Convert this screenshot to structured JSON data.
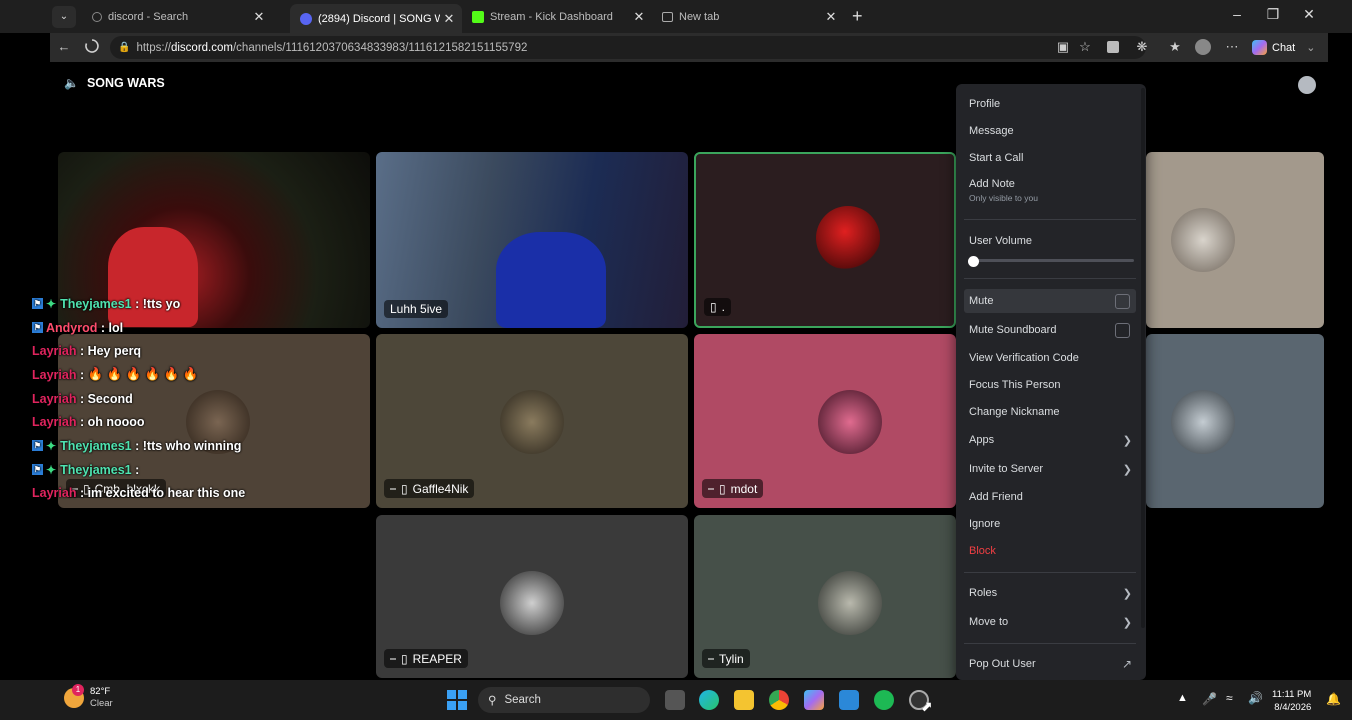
{
  "browser": {
    "tabs": [
      {
        "title": "discord - Search"
      },
      {
        "title": "(2894) Discord | SONG WARS"
      },
      {
        "title": "Stream - Kick Dashboard"
      },
      {
        "title": "New tab"
      }
    ],
    "url_prefix": "https://",
    "url_host": "discord.com",
    "url_path": "/channels/1116120370634833983/1116121582151155792",
    "copilot_label": "Chat"
  },
  "voice": {
    "channel_name": "SONG WARS",
    "tiles": [
      {
        "name": ""
      },
      {
        "name": "Luhh 5ive"
      },
      {
        "name": "."
      },
      {
        "name": ""
      },
      {
        "name": "Cmb_blxckk"
      },
      {
        "name": "Gaffle4Nik"
      },
      {
        "name": "mdot"
      },
      {
        "name": ""
      },
      {
        "name": "REAPER"
      },
      {
        "name": "Tylin"
      }
    ]
  },
  "chat": [
    {
      "user": "Theyjames1",
      "sep": " : ",
      "msg": "!tts yo",
      "color": "#4fe3b0",
      "badges": true
    },
    {
      "user": "Andyrod",
      "sep": " : ",
      "msg": "lol",
      "color": "#ff4d6d",
      "badges": "one"
    },
    {
      "user": "Layriah",
      "sep": " : ",
      "msg": "Hey perq",
      "color": "#e0245e"
    },
    {
      "user": "Layriah",
      "sep": " : ",
      "msg": "🔥 🔥 🔥 🔥 🔥 🔥",
      "color": "#e0245e"
    },
    {
      "user": "Layriah",
      "sep": " : ",
      "msg": "Second",
      "color": "#e0245e"
    },
    {
      "user": "Layriah",
      "sep": " : ",
      "msg": "oh noooo",
      "color": "#e0245e"
    },
    {
      "user": "Theyjames1",
      "sep": " : ",
      "msg": "!tts who winning",
      "color": "#4fe3b0",
      "badges": true
    },
    {
      "user": "Theyjames1",
      "sep": " : ",
      "msg": "",
      "color": "#4fe3b0",
      "badges": true
    },
    {
      "user": "Layriah",
      "sep": " : ",
      "msg": "im excited to hear this one",
      "color": "#e0245e"
    }
  ],
  "menu": {
    "profile": "Profile",
    "message": "Message",
    "start_call": "Start a Call",
    "add_note": "Add Note",
    "add_note_sub": "Only visible to you",
    "user_volume": "User Volume",
    "user_volume_level": 0,
    "mute": "Mute",
    "mute_soundboard": "Mute Soundboard",
    "view_verification": "View Verification Code",
    "focus": "Focus This Person",
    "change_nickname": "Change Nickname",
    "apps": "Apps",
    "invite": "Invite to Server",
    "add_friend": "Add Friend",
    "ignore": "Ignore",
    "block": "Block",
    "roles": "Roles",
    "move_to": "Move to",
    "pop_out": "Pop Out User"
  },
  "taskbar": {
    "weather_temp": "82°F",
    "weather_cond": "Clear",
    "weather_badge": "1",
    "search_label": "Search",
    "time": "11:11 PM",
    "date": "8/4/2026"
  },
  "colors": {
    "menu_bg": "#232428",
    "danger": "#f23f43",
    "speaking_border": "#3ba55c"
  }
}
